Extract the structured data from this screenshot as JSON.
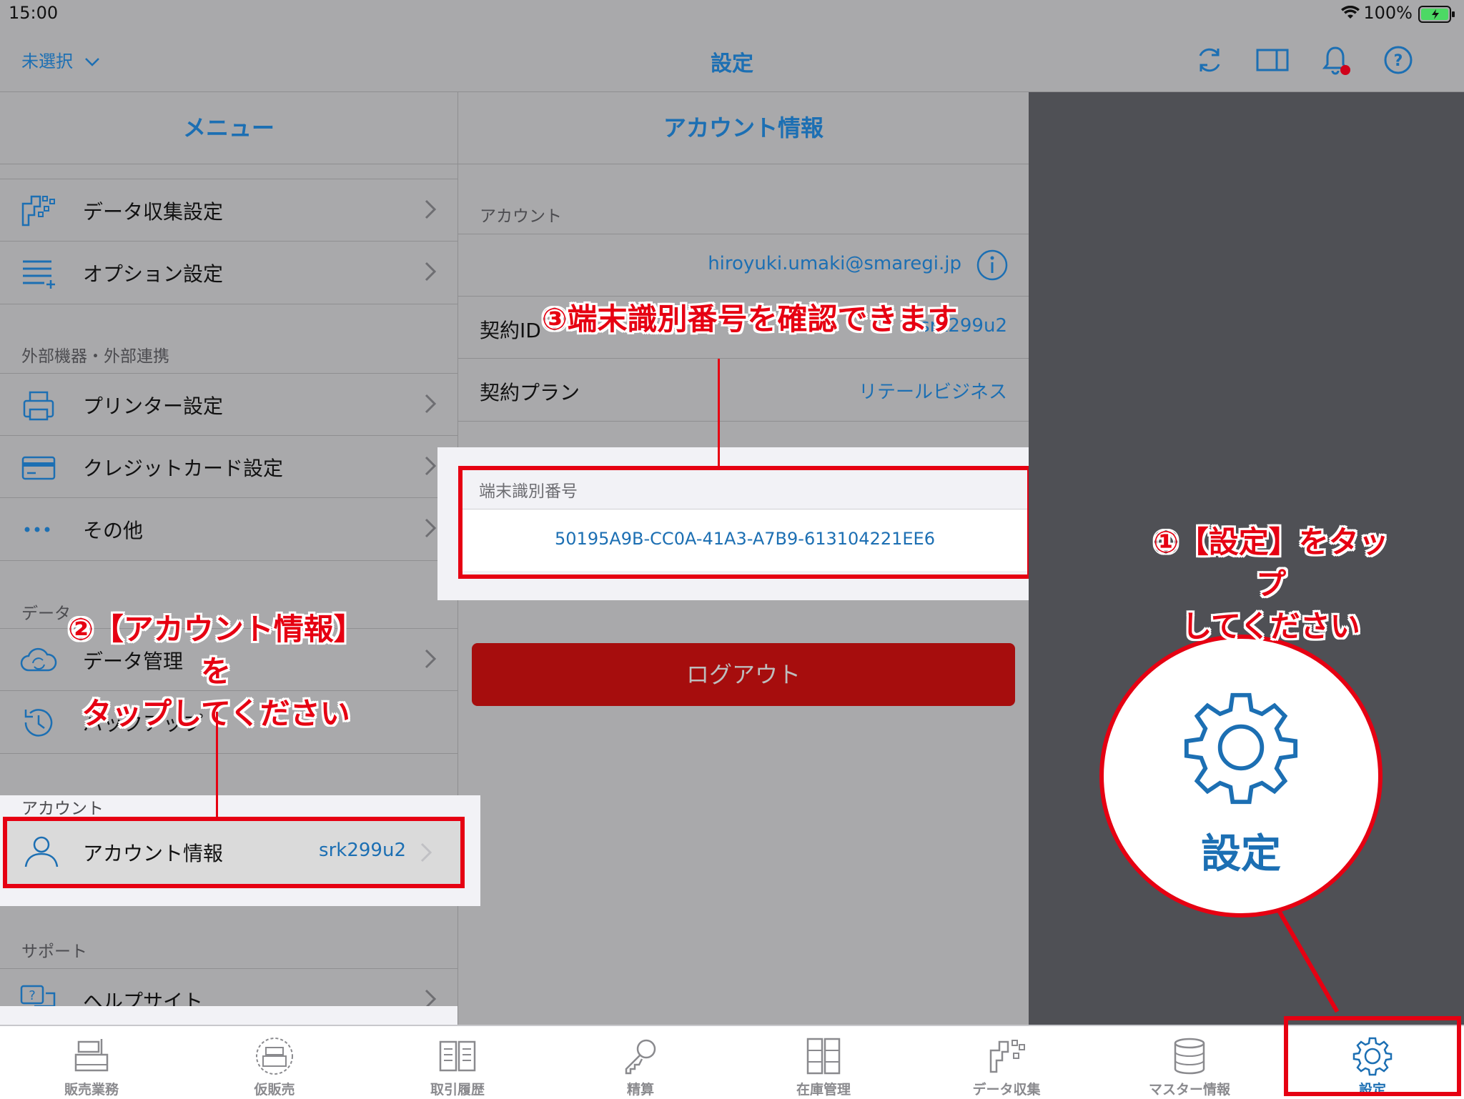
{
  "status_bar": {
    "time": "15:00",
    "battery": "100%"
  },
  "navbar": {
    "store_selector": "未選択",
    "title": "設定"
  },
  "menu": {
    "header": "メニュー",
    "items_top": [
      {
        "label": "データ収集設定",
        "icon": "data-collect-icon"
      },
      {
        "label": "オプション設定",
        "icon": "list-add-icon"
      }
    ],
    "section_external": "外部機器・外部連携",
    "items_external": [
      {
        "label": "プリンター設定",
        "icon": "printer-icon"
      },
      {
        "label": "クレジットカード設定",
        "icon": "credit-card-icon"
      },
      {
        "label": "その他",
        "icon": "more-icon"
      }
    ],
    "section_data": "データ",
    "items_data": [
      {
        "label": "データ管理",
        "icon": "cloud-sync-icon"
      },
      {
        "label": "バックアップ",
        "icon": "clock-back-icon"
      }
    ],
    "section_account": "アカウント",
    "account_item": {
      "label": "アカウント情報",
      "value": "srk299u2",
      "icon": "user-icon"
    },
    "section_support": "サポート",
    "support_item": {
      "label": "ヘルプサイト",
      "icon": "help-chat-icon"
    }
  },
  "detail": {
    "header": "アカウント情報",
    "section_account": "アカウント",
    "email": "hiroyuki.umaki@smaregi.jp",
    "contract_id_label": "契約ID",
    "contract_id_value": "srk299u2",
    "plan_label": "契約プラン",
    "plan_value": "リテールビジネス",
    "device_id_label": "端末識別番号",
    "device_id_value": "50195A9B-CC0A-41A3-A7B9-613104221EE6",
    "logout": "ログアウト"
  },
  "tabs": [
    {
      "label": "販売業務",
      "icon": "register-icon"
    },
    {
      "label": "仮販売",
      "icon": "temp-sale-icon"
    },
    {
      "label": "取引履歴",
      "icon": "history-icon"
    },
    {
      "label": "精算",
      "icon": "key-icon"
    },
    {
      "label": "在庫管理",
      "icon": "inventory-icon"
    },
    {
      "label": "データ収集",
      "icon": "data-collect-icon"
    },
    {
      "label": "マスター情報",
      "icon": "database-icon"
    },
    {
      "label": "設定",
      "icon": "gear-icon",
      "selected": true
    }
  ],
  "annotations": {
    "step1_line1": "①【設定】をタップ",
    "step1_line2": "してください",
    "step2_line1": "②【アカウント情報】を",
    "step2_line2": "タップしてください",
    "step3": "③端末識別番号を確認できます",
    "zoom_label": "設定"
  },
  "colors": {
    "accent": "#1c6fb3",
    "annotation": "#e60012",
    "logout": "#a60d0d"
  }
}
